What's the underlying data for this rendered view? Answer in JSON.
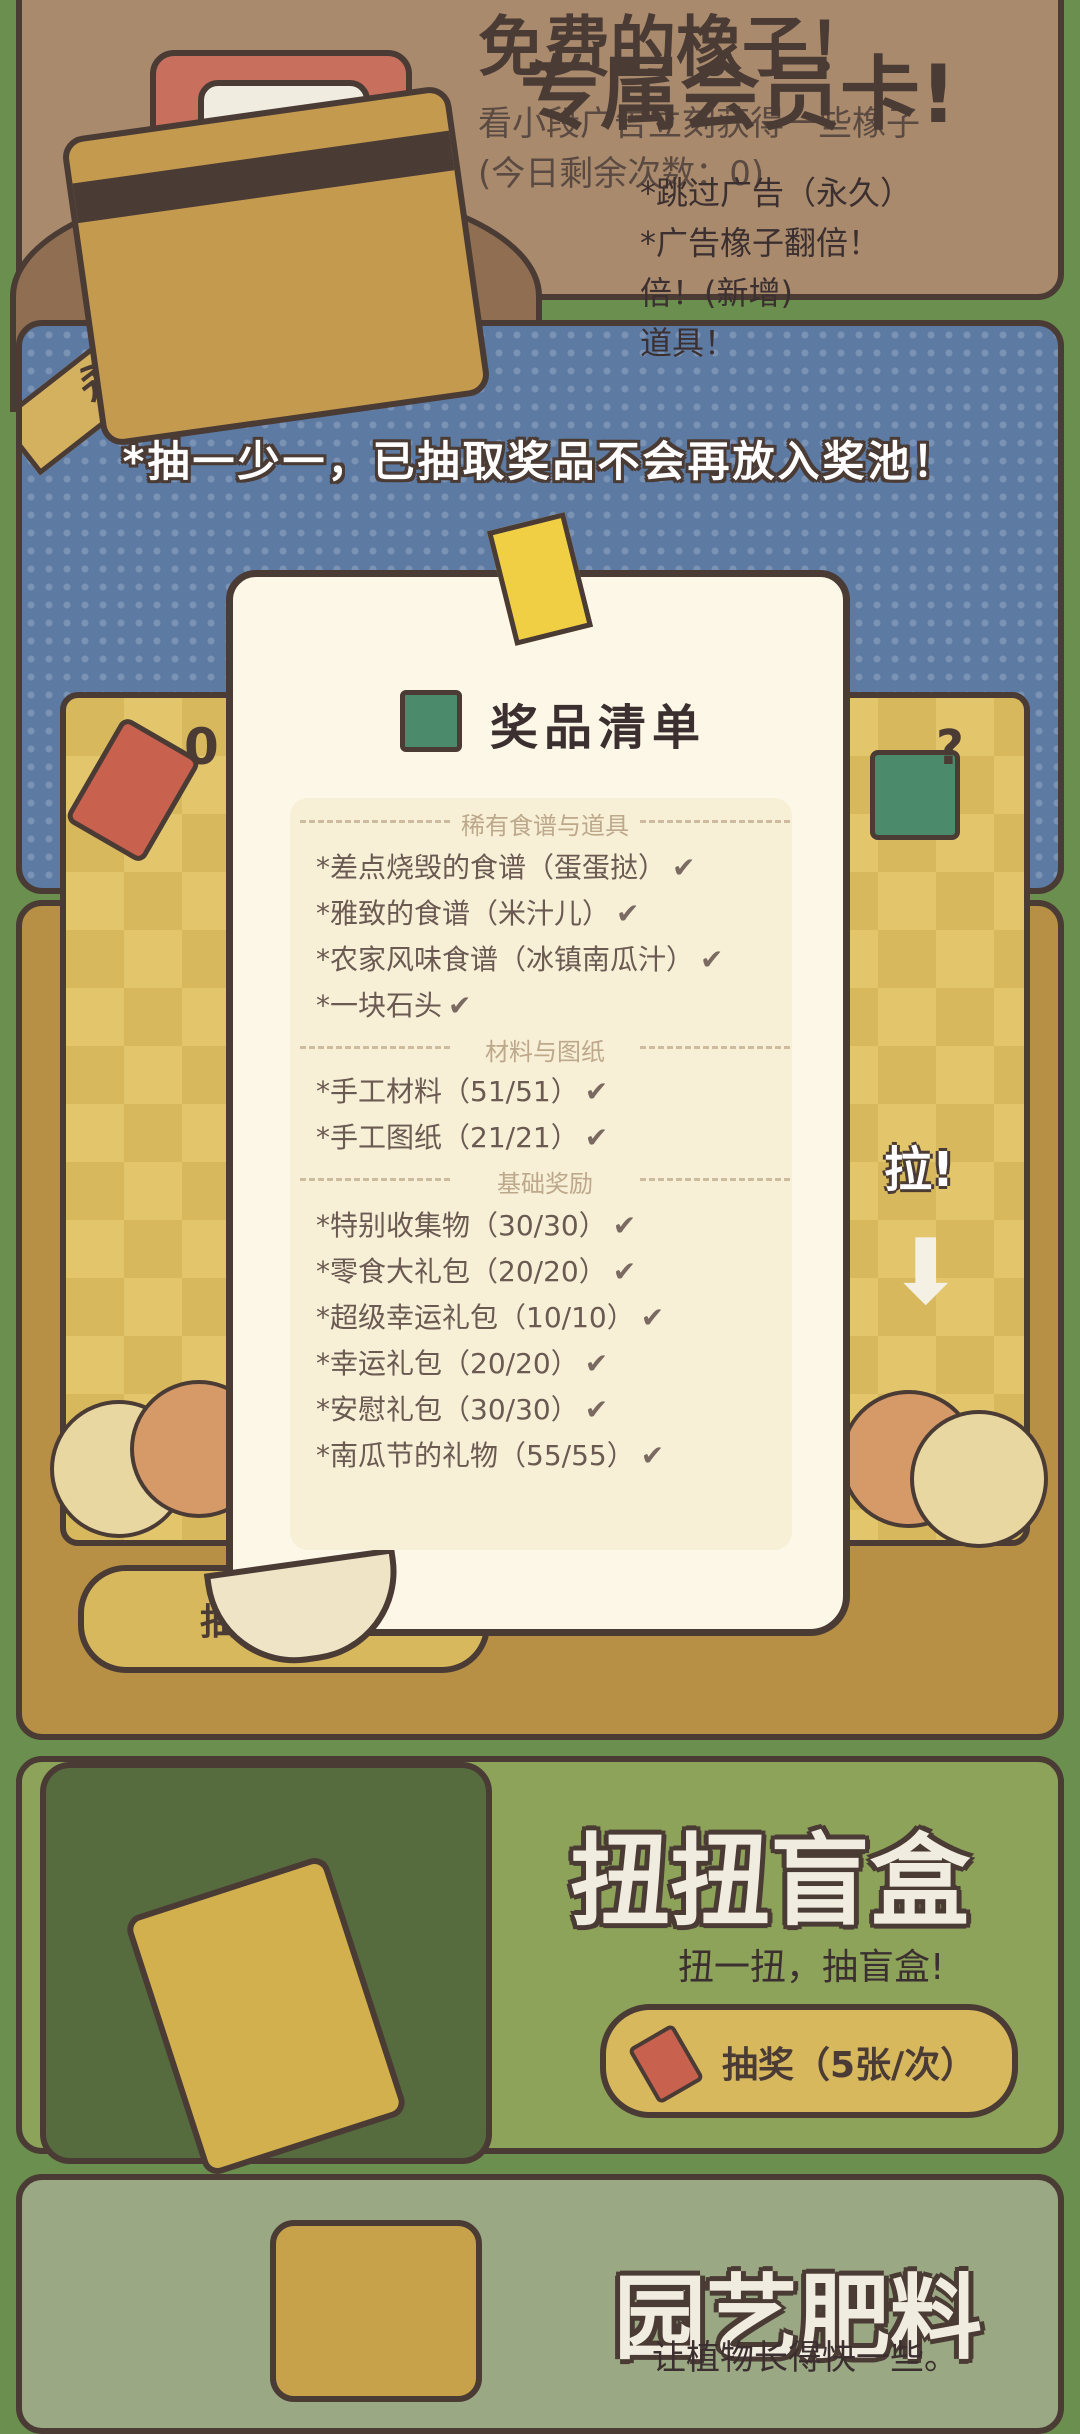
{
  "ad_card": {
    "title": "免费的橡子！",
    "description": "看小段广告立刻获得一些橡子",
    "remaining": "(今日剩余次数：0)"
  },
  "vip_card": {
    "badge": "永久",
    "title": "专属会员卡!",
    "benefits": [
      "*跳过广告（永久）",
      "*广告橡子翻倍！",
      "倍！(新增)",
      "道具！"
    ]
  },
  "banner": "*抽一少一，已抽取奖品不会再放入奖池！",
  "lottery": {
    "ticket_count": "0",
    "pull_label": "拉!",
    "button_label": "抽奖"
  },
  "prize_list": {
    "title": "奖品清单",
    "sections": [
      {
        "heading": "稀有食谱与道具",
        "items": [
          "*差点烧毁的食谱（蛋蛋挞）",
          "*雅致的食谱（米汁儿）",
          "*农家风味食谱（冰镇南瓜汁）",
          "*一块石头"
        ]
      },
      {
        "heading": "材料与图纸",
        "items": [
          "*手工材料（51/51）",
          "*手工图纸（21/21）"
        ]
      },
      {
        "heading": "基础奖励",
        "items": [
          "*特别收集物（30/30）",
          "*零食大礼包（20/20）",
          "*超级幸运礼包（10/10）",
          "*幸运礼包（20/20）",
          "*安慰礼包（30/30）",
          "*南瓜节的礼物（55/55）"
        ]
      }
    ],
    "check_glyph": "✔"
  },
  "gacha": {
    "title": "扭扭盲盒",
    "subtitle": "扭一扭，抽盲盒!",
    "button_label": "抽奖（5张/次）"
  },
  "garden": {
    "title": "园艺肥料",
    "subtitle": "让植物长得快一些。"
  }
}
